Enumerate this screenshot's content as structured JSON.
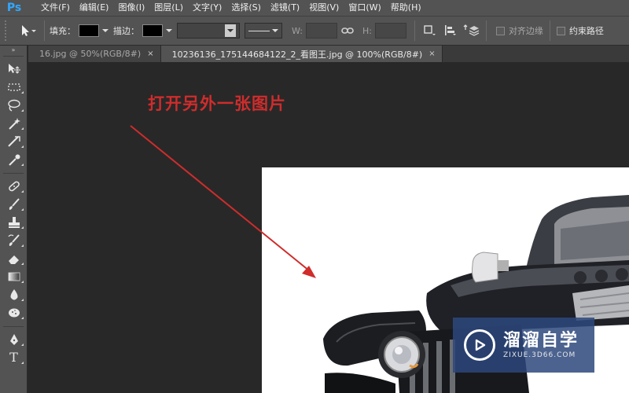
{
  "app": {
    "logo": "Ps"
  },
  "menu": [
    {
      "label": "文件(F)"
    },
    {
      "label": "编辑(E)"
    },
    {
      "label": "图像(I)"
    },
    {
      "label": "图层(L)"
    },
    {
      "label": "文字(Y)"
    },
    {
      "label": "选择(S)"
    },
    {
      "label": "滤镜(T)"
    },
    {
      "label": "视图(V)"
    },
    {
      "label": "窗口(W)"
    },
    {
      "label": "帮助(H)"
    }
  ],
  "options": {
    "fill_label": "填充：",
    "stroke_label": "描边：",
    "fill_color": "#000000",
    "stroke_color": "#000000",
    "w_label": "W:",
    "h_label": "H:",
    "align_edges_label": "对齐边缘",
    "constrain_path_label": "约束路径"
  },
  "tabs": [
    {
      "label": "16.jpg @ 50%(RGB/8#)",
      "close": "×",
      "active": false
    },
    {
      "label": "10236136_175144684122_2_看图王.jpg @ 100%(RGB/8#)",
      "close": "×",
      "active": true
    }
  ],
  "toolbar": {
    "collapse_arrow": "»",
    "type_tool_glyph": "T"
  },
  "canvas": {
    "annotation": "打开另外一张图片",
    "annotation_color": "#d02c2c",
    "document_background": "#ffffff"
  },
  "watermark": {
    "title": "溜溜自学",
    "url": "ZIXUE.3D66.COM",
    "background": "#2d487d"
  }
}
